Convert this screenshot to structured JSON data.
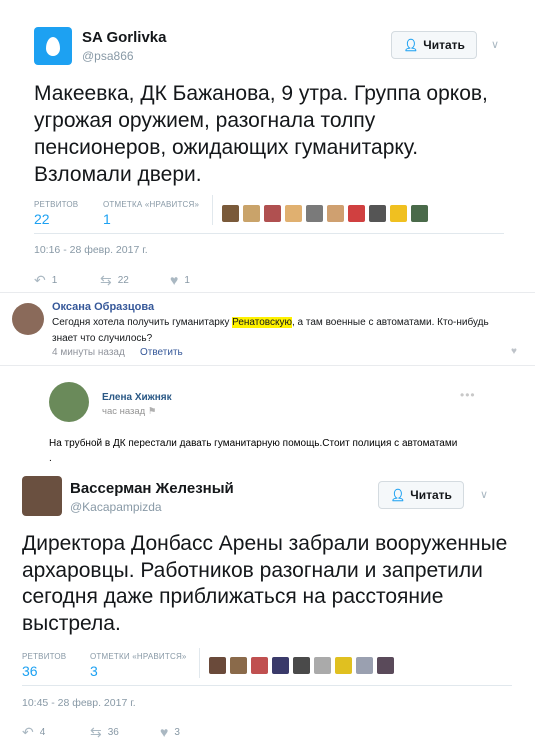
{
  "tweet1": {
    "name": "SA Gorlivka",
    "handle": "@psa866",
    "follow_label": "Читать",
    "text": "Макеевка, ДК Бажанова, 9 утра. Группа орков, угрожая оружием, разогнала толпу пенсионеров, ожидающих гуманитарку. Взломали двери.",
    "retweets_label": "РЕТВИТОВ",
    "retweets": "22",
    "likes_label": "ОТМЕТКА «НРАВИТСЯ»",
    "likes": "1",
    "timestamp": "10:16 - 28 февр. 2017 г.",
    "reply_count": "1",
    "retweet_count": "22",
    "like_count": "1",
    "face_colors": [
      "#7a5a3a",
      "#c9a36a",
      "#b05050",
      "#e0b070",
      "#7a7a7a",
      "#cfa070",
      "#d04040",
      "#555555",
      "#f0c020",
      "#4a6a4a"
    ]
  },
  "comment": {
    "author": "Оксана Образцова",
    "text_before": "Сегодня хотела получить гуманитарку ",
    "highlight": "Ренатовскую",
    "text_after": ", а там военные с автоматами. Кто-нибудь знает что случилось?",
    "time": "4 минуты назад",
    "reply": "Ответить"
  },
  "post": {
    "author": "Елена Хижняк",
    "time": "час назад",
    "text": "На трубной в ДК перестали давать гуманитарную помощь.Стоит полиция с автоматами ."
  },
  "tweet2": {
    "name": "Вассерман Железный",
    "handle": "@Kacapampizda",
    "follow_label": "Читать",
    "text": "Директора Донбасс Арены забрали вооруженные архаровцы. Работников разогнали и запретили сегодня даже приближаться на расстояние выстрела.",
    "retweets_label": "РЕТВИТОВ",
    "retweets": "36",
    "likes_label": "ОТМЕТКИ «НРАВИТСЯ»",
    "likes": "3",
    "timestamp": "10:45 - 28 февр. 2017 г.",
    "reply_count": "4",
    "retweet_count": "36",
    "like_count": "3",
    "face_colors": [
      "#6a4a3a",
      "#8a6a4a",
      "#c05050",
      "#3a3a6a",
      "#4a4a4a",
      "#aaaaaa",
      "#e0c020",
      "#9aa0b0",
      "#5a4a5a"
    ]
  }
}
